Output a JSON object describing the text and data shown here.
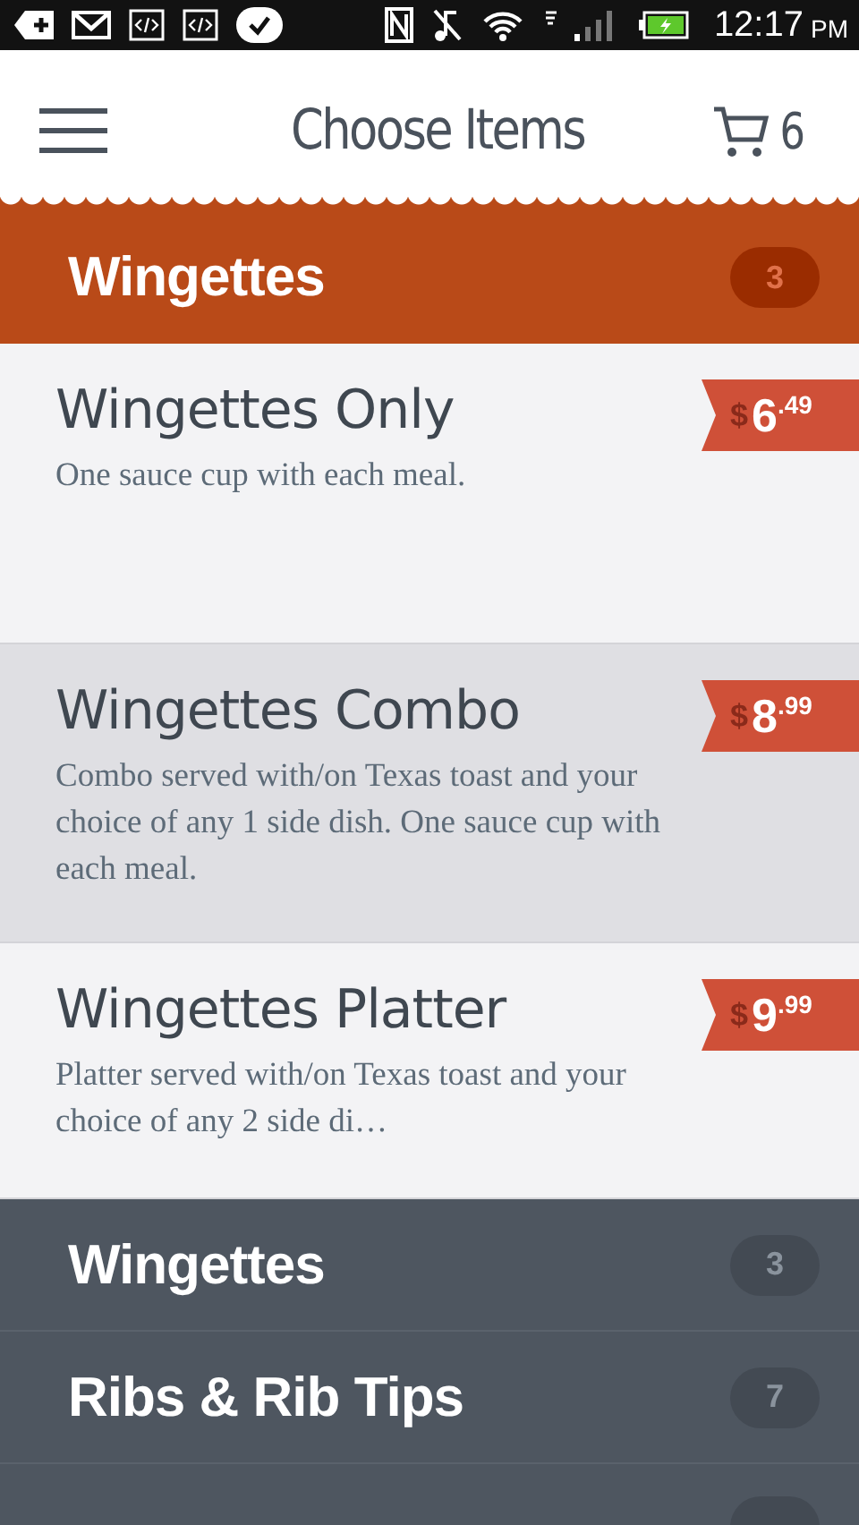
{
  "status_bar": {
    "time": "12:17",
    "meridiem": "PM"
  },
  "header": {
    "title": "Choose Items",
    "cart_count": "6"
  },
  "category": {
    "name": "Wingettes",
    "count": "3"
  },
  "items": [
    {
      "name": "Wingettes Only",
      "description": "One sauce cup with each meal.",
      "currency": "$",
      "whole": "6",
      "cents": ".49",
      "selected": false
    },
    {
      "name": "Wingettes Combo",
      "description": "Combo served with/on Texas toast and your choice of any 1 side dish.  One sauce cup with each meal.",
      "currency": "$",
      "whole": "8",
      "cents": ".99",
      "selected": true
    },
    {
      "name": "Wingettes Platter",
      "description": "Platter served with/on Texas toast and your choice of any 2 side di…",
      "currency": "$",
      "whole": "9",
      "cents": ".99",
      "selected": false
    }
  ],
  "categories": [
    {
      "name": "Wingettes",
      "count": "3"
    },
    {
      "name": "Ribs & Rib Tips",
      "count": "7"
    }
  ]
}
